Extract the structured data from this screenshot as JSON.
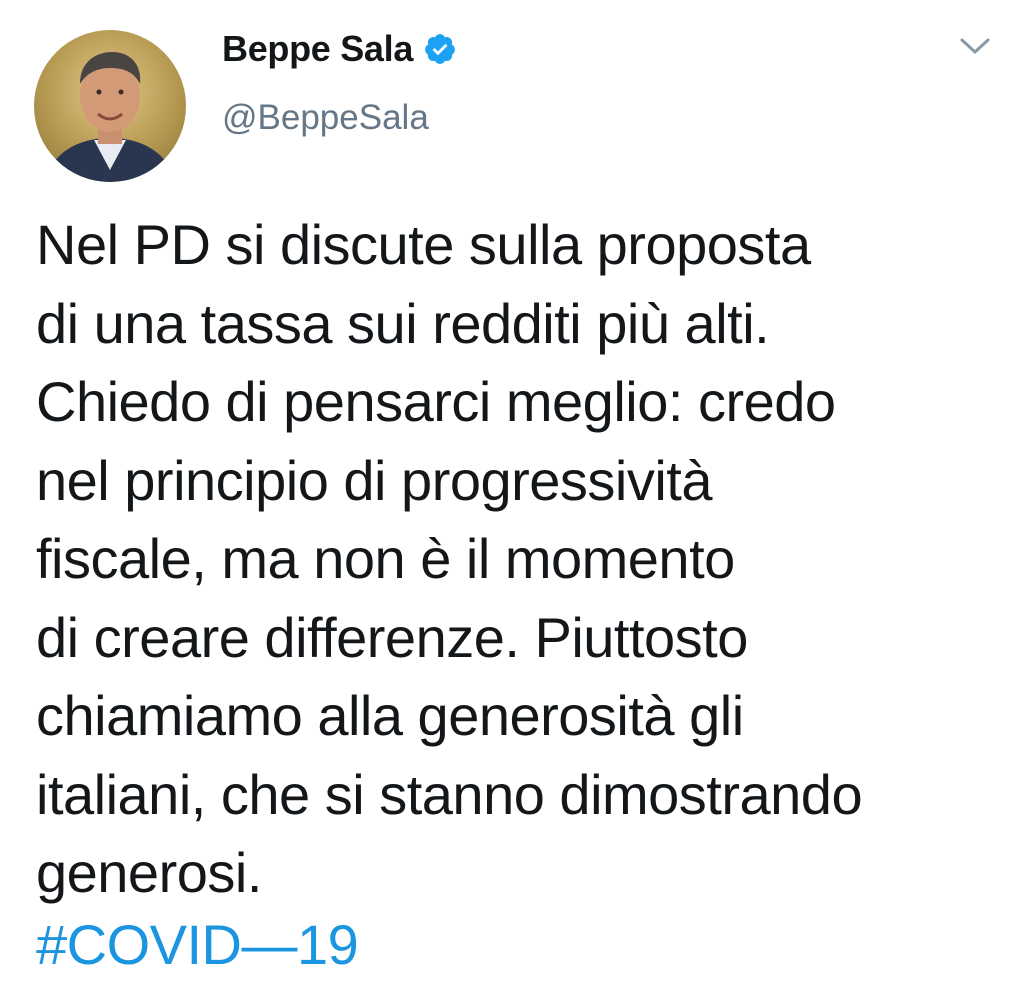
{
  "author": {
    "display_name": "Beppe Sala",
    "handle": "@BeppeSala",
    "verified": true,
    "avatar_icon": "avatar-photo"
  },
  "tweet": {
    "lines": [
      "Nel PD si discute sulla proposta",
      "di una tassa sui redditi più alti.",
      "Chiedo di pensarci meglio: credo",
      "nel principio di progressività",
      "fiscale, ma non è il momento",
      "di creare differenze. Piuttosto",
      "chiamiamo alla generosità gli",
      "italiani, che si stanno dimostrando",
      "generosi."
    ],
    "hashtag": "#COVID—19"
  },
  "icons": {
    "verified": "verified-badge-icon",
    "menu": "chevron-down-icon"
  },
  "colors": {
    "text": "#14171a",
    "secondary": "#657786",
    "link": "#1b95e0",
    "verified": "#1da1f2"
  }
}
